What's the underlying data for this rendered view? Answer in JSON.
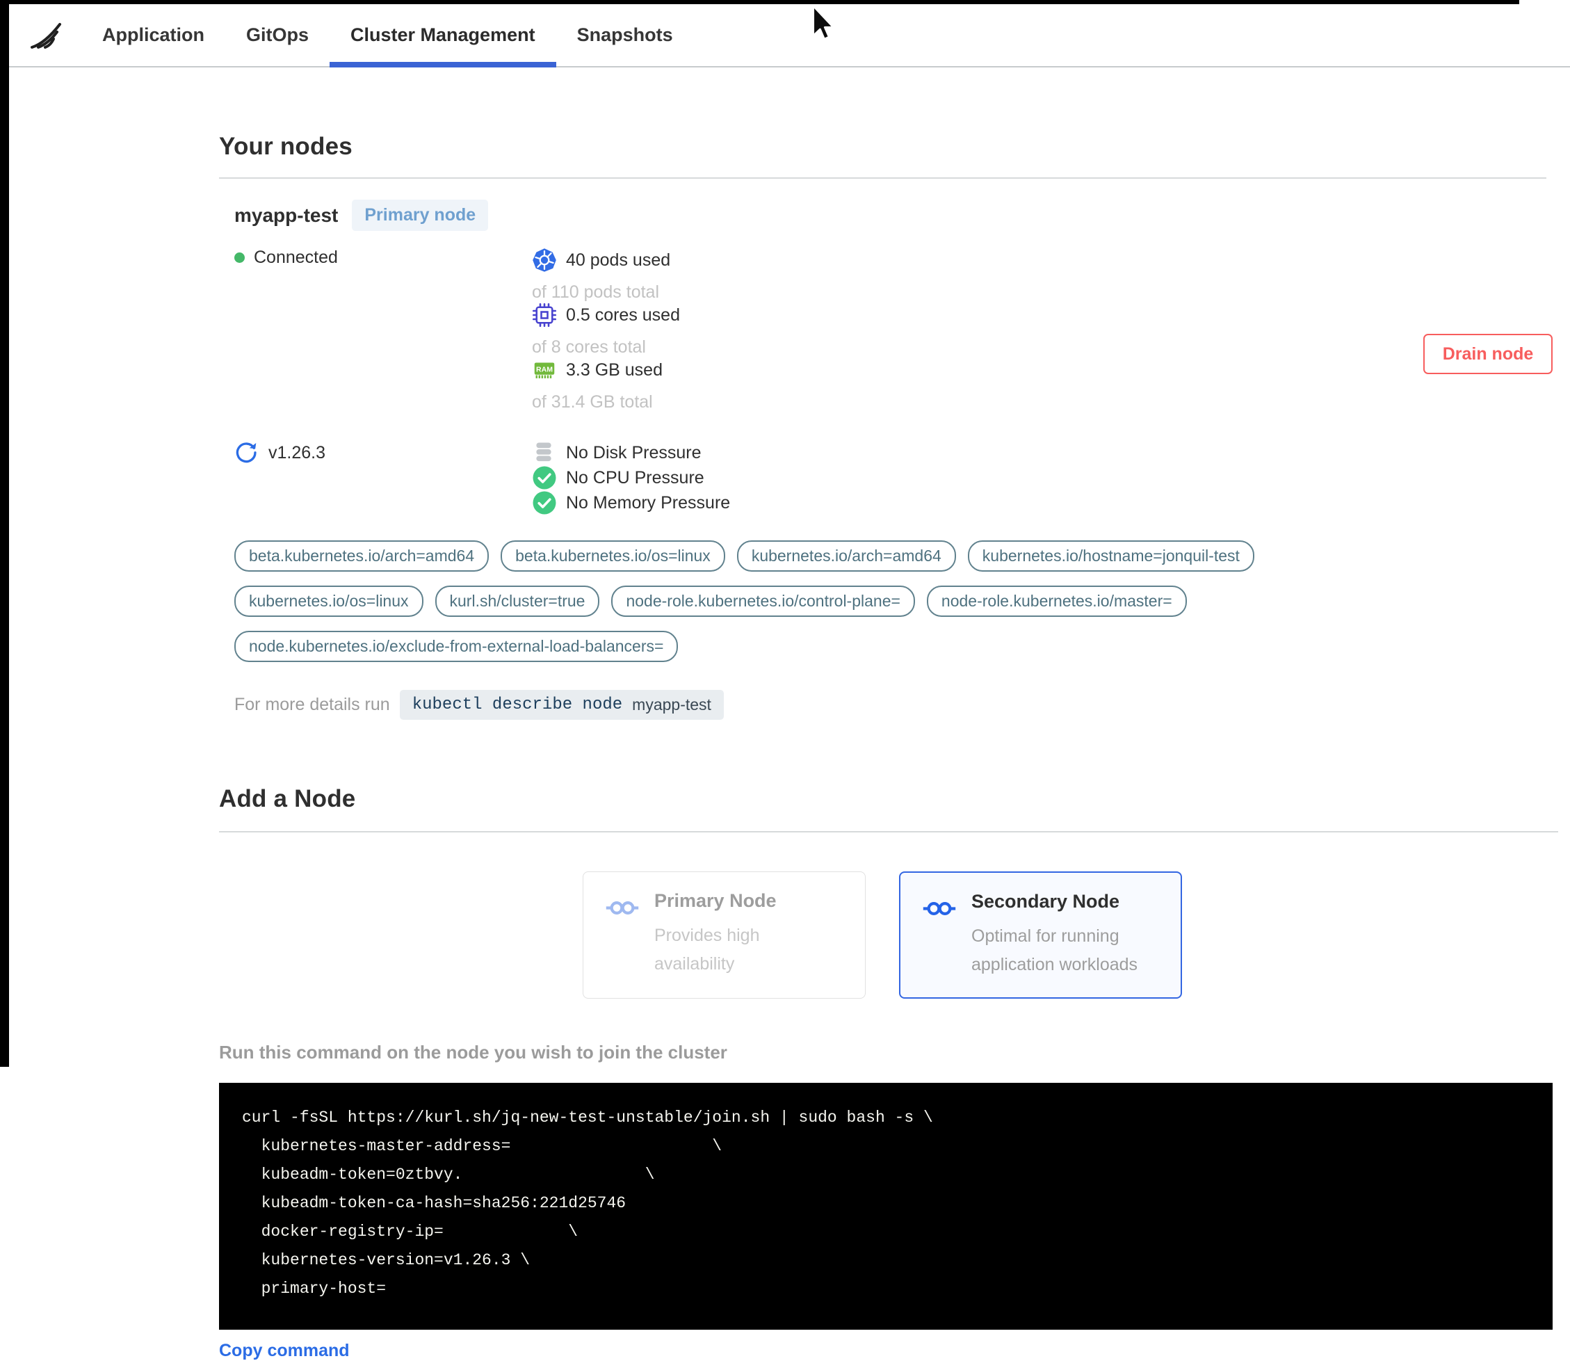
{
  "nav": {
    "tabs": [
      {
        "label": "Application",
        "active": false
      },
      {
        "label": "GitOps",
        "active": false
      },
      {
        "label": "Cluster Management",
        "active": true
      },
      {
        "label": "Snapshots",
        "active": false
      }
    ]
  },
  "your_nodes": {
    "title": "Your nodes",
    "node": {
      "name": "myapp-test",
      "badge": "Primary node",
      "status": "Connected",
      "version": "v1.26.3",
      "stats": [
        {
          "icon": "kubernetes-icon",
          "used": "40 pods used",
          "total": "of 110 pods total"
        },
        {
          "icon": "cpu-icon",
          "used": "0.5 cores used",
          "total": "of 8 cores total"
        },
        {
          "icon": "ram-icon",
          "used": "3.3 GB used",
          "total": "of 31.4 GB total"
        }
      ],
      "conditions": [
        {
          "icon": "disk-icon",
          "label": "No Disk Pressure"
        },
        {
          "icon": "check-circle-icon",
          "label": "No CPU Pressure"
        },
        {
          "icon": "check-circle-icon",
          "label": "No Memory Pressure"
        }
      ],
      "labels": [
        "beta.kubernetes.io/arch=amd64",
        "beta.kubernetes.io/os=linux",
        "kubernetes.io/arch=amd64",
        "kubernetes.io/hostname=jonquil-test",
        "kubernetes.io/os=linux",
        "kurl.sh/cluster=true",
        "node-role.kubernetes.io/control-plane=",
        "node-role.kubernetes.io/master=",
        "node.kubernetes.io/exclude-from-external-load-balancers="
      ],
      "drain_button": "Drain node",
      "details_prefix": "For more details run",
      "details_command": "kubectl describe node",
      "details_node": "myapp-test"
    }
  },
  "add_node": {
    "title": "Add a Node",
    "options": [
      {
        "title": "Primary Node",
        "description": "Provides high availability",
        "selected": false
      },
      {
        "title": "Secondary Node",
        "description": "Optimal for running application workloads",
        "selected": true
      }
    ],
    "instruction": "Run this command on the node you wish to join the cluster",
    "command_lines": [
      "curl -fsSL https://kurl.sh/jq-new-test-unstable/join.sh | sudo bash -s \\",
      "  kubernetes-master-address=                     \\",
      "  kubeadm-token=0ztbvy.                   \\",
      "  kubeadm-token-ca-hash=sha256:221d25746",
      "  docker-registry-ip=             \\",
      "  kubernetes-version=v1.26.3 \\",
      "  primary-host="
    ],
    "copy_label": "Copy command"
  },
  "colors": {
    "accent_blue": "#2b6ce5",
    "tag_teal": "#4e717f",
    "danger_red": "#f75d5d",
    "success_green": "#41c981",
    "ram_green": "#72b93c"
  }
}
